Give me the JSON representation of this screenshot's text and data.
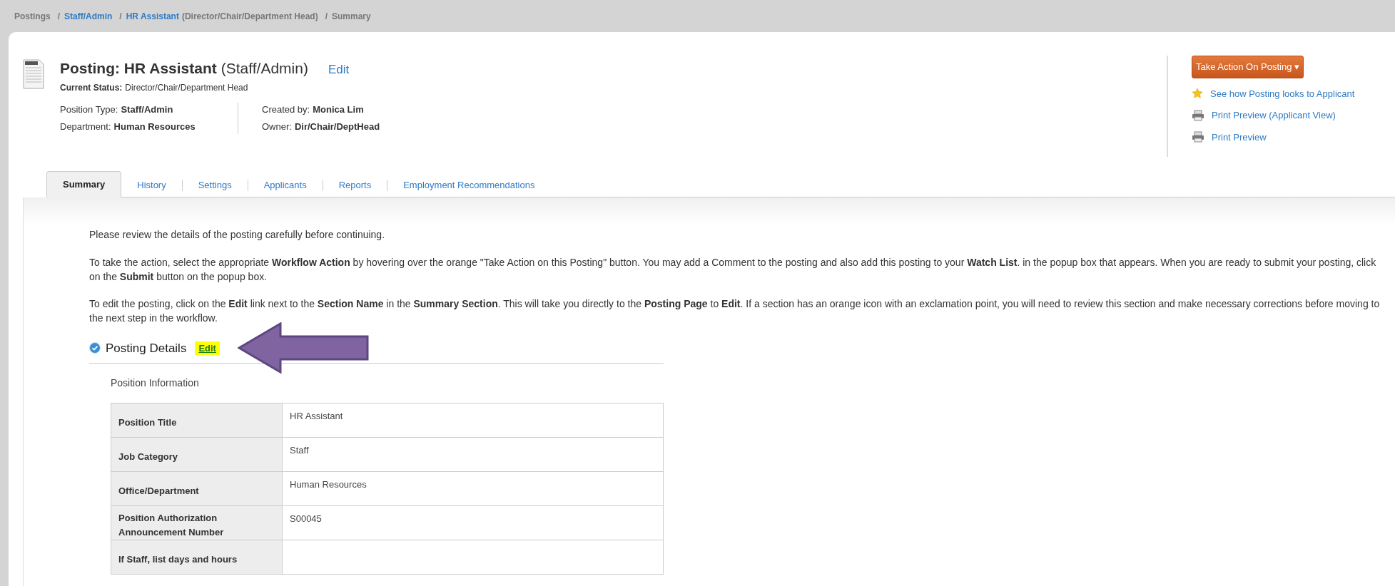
{
  "breadcrumb": [
    {
      "text": "Postings",
      "kind": "text"
    },
    {
      "text": "/",
      "kind": "sep"
    },
    {
      "text": "Staff/Admin",
      "kind": "link"
    },
    {
      "text": "/",
      "kind": "sep"
    },
    {
      "text": "HR Assistant",
      "kind": "link"
    },
    {
      "text": "(Director/Chair/Department Head)",
      "kind": "text"
    },
    {
      "text": "/",
      "kind": "sep"
    },
    {
      "text": "Summary",
      "kind": "text"
    }
  ],
  "header": {
    "title": "Posting: HR Assistant",
    "title_suffix": "(Staff/Admin)",
    "edit": "Edit",
    "status_label": "Current Status:",
    "status": "Director/Chair/Department Head",
    "meta_left": [
      {
        "label": "Position Type:",
        "value": "Staff/Admin"
      },
      {
        "label": "Department:",
        "value": "Human Resources"
      }
    ],
    "meta_right": [
      {
        "label": "Created by:",
        "value": "Monica Lim"
      },
      {
        "label": "Owner:",
        "value": "Dir/Chair/DeptHead"
      }
    ]
  },
  "actions": {
    "button": "Take Action On Posting",
    "caret": "▾",
    "links": [
      {
        "text": "See how Posting looks to Applicant",
        "kind": "star"
      },
      {
        "text": "Print Preview (Applicant View)",
        "kind": "printer"
      },
      {
        "text": "Print Preview",
        "kind": "printer"
      }
    ]
  },
  "tabs": [
    {
      "label": "Summary",
      "selected": true
    },
    {
      "label": "History",
      "selected": false
    },
    {
      "label": "Settings",
      "selected": false
    },
    {
      "label": "Applicants",
      "selected": false
    },
    {
      "label": "Reports",
      "selected": false
    },
    {
      "label": "Employment Recommendations",
      "selected": false
    }
  ],
  "paragraphs": [
    "Please review the details of the posting carefully before continuing.",
    "To take the action, select the appropriate **Workflow Action** by hovering over the orange \"Take Action on this Posting\" button. You may add a Comment to the posting and also add this posting to your **Watch List**. in the popup box that appears. When you are ready to submit your posting, click on the **Submit** button on the popup box.",
    "To edit the posting, click on the **Edit** link next to the **Section Name** in the **Summary Section**. This will take you directly to the **Posting Page** to **Edit**. If a section has an orange icon with an exclamation point, you will need to review this section and make necessary corrections before moving to the next step in the workflow."
  ],
  "section": {
    "title": "Posting Details",
    "edit": "Edit",
    "edit_highlighted": true,
    "subtitle": "Position Information",
    "rows": [
      {
        "label": "Position Title",
        "value": "HR Assistant"
      },
      {
        "label": "Job Category",
        "value": "Staff"
      },
      {
        "label": "Office/Department",
        "value": "Human Resources"
      },
      {
        "label": "Position Authorization Announcement Number",
        "value": "S00045"
      },
      {
        "label": "If Staff, list days and hours"
      }
    ]
  }
}
